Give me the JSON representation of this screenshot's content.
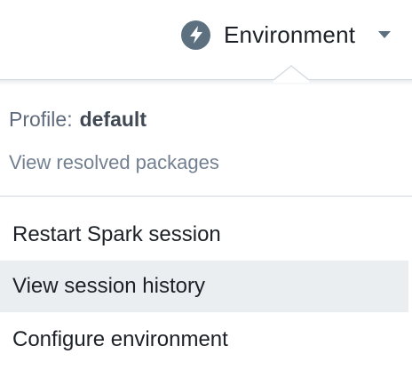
{
  "environment_button": {
    "label": "Environment",
    "icon": "lightning-bolt-icon",
    "icon_color": "#5c7080"
  },
  "popover": {
    "profile_label": "Profile:",
    "profile_value": "default",
    "resolved_link": "View resolved packages",
    "menu_items": [
      {
        "label": "Restart Spark session",
        "highlighted": false
      },
      {
        "label": "View session history",
        "highlighted": true
      },
      {
        "label": "Configure environment",
        "highlighted": false
      }
    ]
  }
}
